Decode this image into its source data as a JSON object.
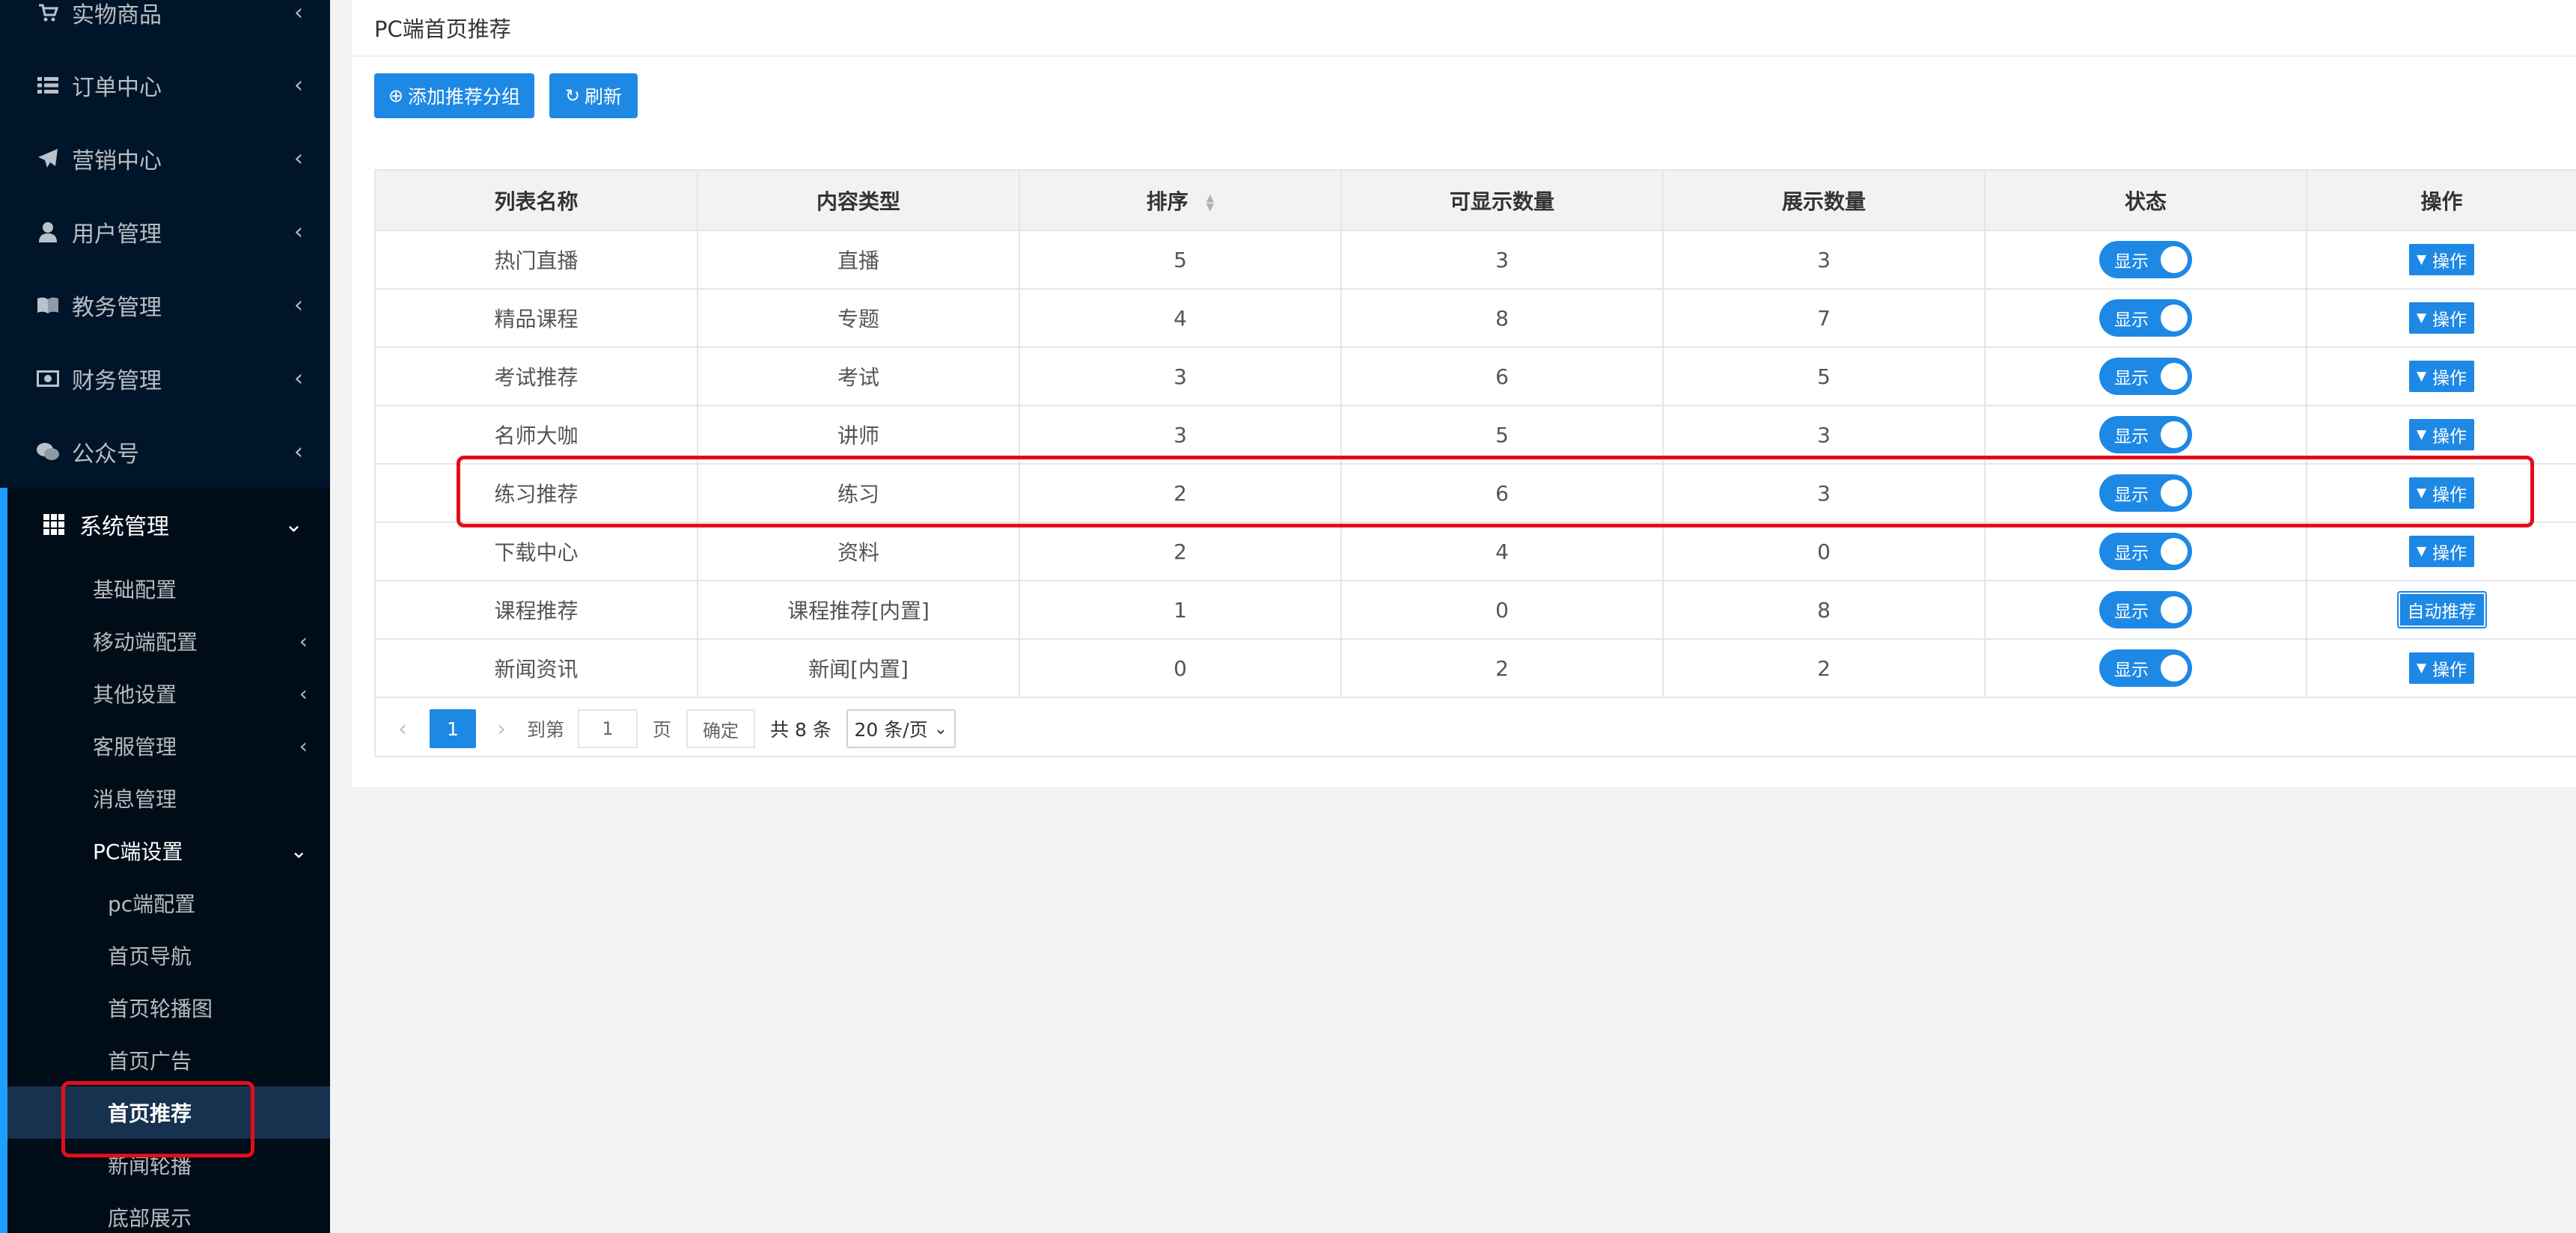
{
  "sidebar": {
    "items": [
      {
        "label": "实物商品",
        "icon": "cart-icon"
      },
      {
        "label": "订单中心",
        "icon": "list-icon"
      },
      {
        "label": "营销中心",
        "icon": "paper-plane-icon"
      },
      {
        "label": "用户管理",
        "icon": "user-icon"
      },
      {
        "label": "教务管理",
        "icon": "book-icon"
      },
      {
        "label": "财务管理",
        "icon": "money-icon"
      },
      {
        "label": "公众号",
        "icon": "wechat-icon"
      }
    ],
    "system": {
      "label": "系统管理",
      "icon": "grid-icon",
      "children": [
        {
          "label": "基础配置",
          "has_arrow": false
        },
        {
          "label": "移动端配置",
          "has_arrow": true
        },
        {
          "label": "其他设置",
          "has_arrow": true
        },
        {
          "label": "客服管理",
          "has_arrow": true
        },
        {
          "label": "消息管理",
          "has_arrow": false
        }
      ],
      "pc": {
        "label": "PC端设置",
        "children": [
          {
            "label": "pc端配置"
          },
          {
            "label": "首页导航"
          },
          {
            "label": "首页轮播图"
          },
          {
            "label": "首页广告"
          },
          {
            "label": "首页推荐",
            "active": true
          },
          {
            "label": "新闻轮播"
          },
          {
            "label": "底部展示"
          }
        ]
      }
    }
  },
  "main": {
    "title": "PC端首页推荐",
    "add_button": "添加推荐分组",
    "refresh_button": "刷新"
  },
  "table": {
    "headers": [
      "列表名称",
      "内容类型",
      "排序",
      "可显示数量",
      "展示数量",
      "状态",
      "操作"
    ],
    "rows": [
      {
        "name": "热门直播",
        "type": "直播",
        "order": "5",
        "max": "3",
        "shown": "3",
        "status": "显示",
        "action": "操作"
      },
      {
        "name": "精品课程",
        "type": "专题",
        "order": "4",
        "max": "8",
        "shown": "7",
        "status": "显示",
        "action": "操作"
      },
      {
        "name": "考试推荐",
        "type": "考试",
        "order": "3",
        "max": "6",
        "shown": "5",
        "status": "显示",
        "action": "操作"
      },
      {
        "name": "名师大咖",
        "type": "讲师",
        "order": "3",
        "max": "5",
        "shown": "3",
        "status": "显示",
        "action": "操作"
      },
      {
        "name": "练习推荐",
        "type": "练习",
        "order": "2",
        "max": "6",
        "shown": "3",
        "status": "显示",
        "action": "操作"
      },
      {
        "name": "下载中心",
        "type": "资料",
        "order": "2",
        "max": "4",
        "shown": "0",
        "status": "显示",
        "action": "操作"
      },
      {
        "name": "课程推荐",
        "type": "课程推荐[内置]",
        "order": "1",
        "max": "0",
        "shown": "8",
        "status": "显示",
        "action": "自动推荐"
      },
      {
        "name": "新闻资讯",
        "type": "新闻[内置]",
        "order": "0",
        "max": "2",
        "shown": "2",
        "status": "显示",
        "action": "操作"
      }
    ]
  },
  "pager": {
    "current_page": "1",
    "goto_label": "到第",
    "goto_value": "1",
    "page_label": "页",
    "confirm_label": "确定",
    "total_label": "共 8 条",
    "page_size": "20 条/页"
  },
  "colors": {
    "sidebar_bg": "#001529",
    "accent": "#1e88e5",
    "highlight_frame": "#e30e1a"
  }
}
